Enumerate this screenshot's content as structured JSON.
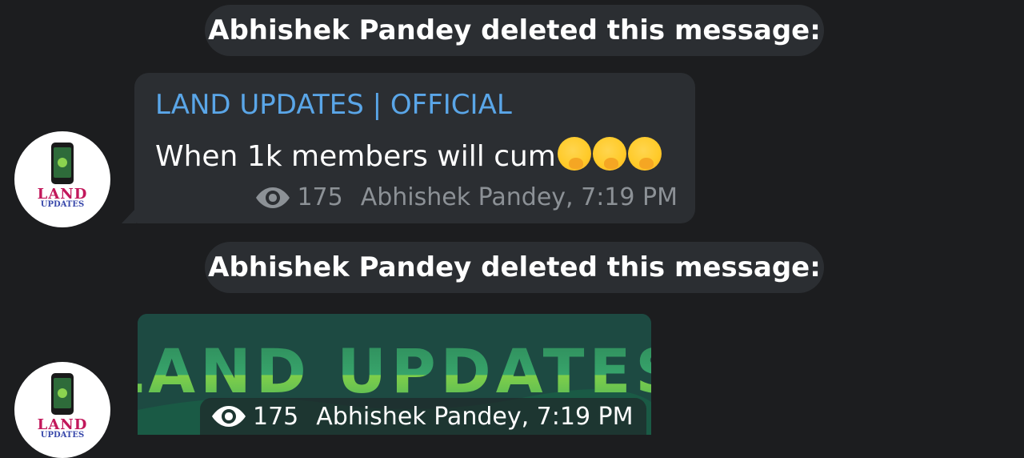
{
  "colors": {
    "background": "#1c1d1f",
    "bubble": "#2b2e32",
    "channel_name": "#5aa6e8",
    "meta_text": "#8c9196",
    "sticker_bg": "#1d4a42"
  },
  "messages": [
    {
      "service_text": "Abhishek Pandey deleted this message:",
      "avatar": {
        "logo_line1": "LAND",
        "logo_line2": "UPDATES"
      },
      "channel_name": "LAND UPDATES | OFFICIAL",
      "text": "When 1k members will cum",
      "emojis": [
        "thinking-face-emoji",
        "thinking-face-emoji",
        "thinking-face-emoji"
      ],
      "views": "175",
      "signature": "Abhishek Pandey, 7:19 PM"
    },
    {
      "service_text": "Abhishek Pandey deleted this message:",
      "avatar": {
        "logo_line1": "LAND",
        "logo_line2": "UPDATES"
      },
      "sticker_text": "LAND UPDATES",
      "views": "175",
      "signature": "Abhishek Pandey, 7:19 PM"
    }
  ]
}
